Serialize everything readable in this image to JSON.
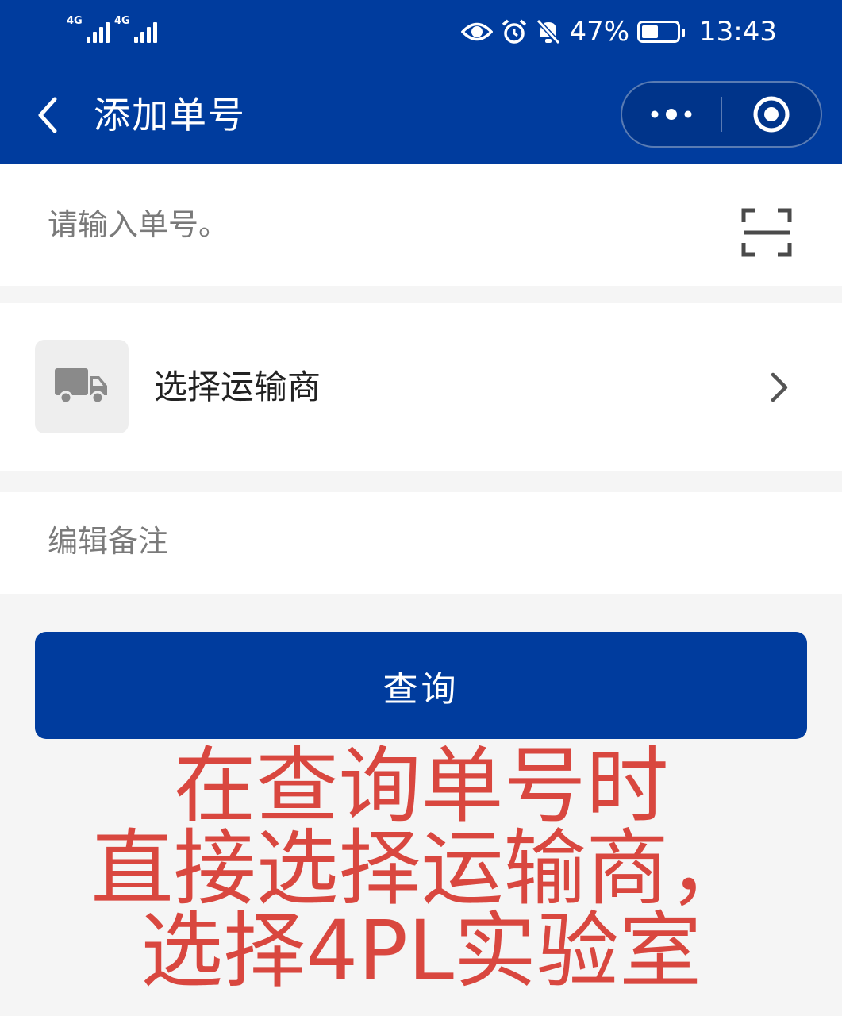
{
  "status_bar": {
    "network_1": "4G",
    "network_2": "4G",
    "battery_percent": "47%",
    "battery_level": 0.47,
    "time": "13:43",
    "icons": [
      "eye-icon",
      "alarm-icon",
      "bell-off-icon",
      "battery-icon"
    ]
  },
  "nav": {
    "title": "添加单号",
    "back_icon": "chevron-left-icon",
    "menu_icon": "more-dots-icon",
    "close_icon": "target-circle-icon"
  },
  "form": {
    "tracking_placeholder": "请输入单号。",
    "scan_icon": "scan-frame-icon",
    "carrier_label": "选择运输商",
    "carrier_icon": "truck-icon",
    "remark_placeholder": "编辑备注"
  },
  "query_button_label": "查询",
  "annotation": {
    "line1": "在查询单号时",
    "line2": "直接选择运输商，",
    "line3": "选择4PL实验室"
  },
  "colors": {
    "primary": "#003c9e",
    "annotation": "#d9473f",
    "background": "#f5f5f5"
  }
}
